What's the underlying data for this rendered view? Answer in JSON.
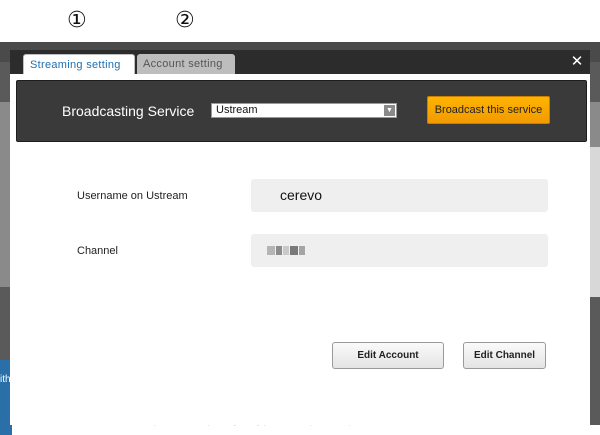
{
  "annotations": [
    "①",
    "②"
  ],
  "background": {
    "left_text": "ith",
    "footer_text": "Online Manual | Terms of Use | Privacy Policy | Contact Us | About Us | 日本語"
  },
  "dialog": {
    "tabs": [
      {
        "label": "Streaming setting",
        "active": true
      },
      {
        "label": "Account setting",
        "active": false
      }
    ],
    "close_label": "✕",
    "service": {
      "label": "Broadcasting Service",
      "selected": "Ustream",
      "broadcast_button": "Broadcast this service"
    },
    "username": {
      "label": "Username on Ustream",
      "value": "cerevo"
    },
    "channel": {
      "label": "Channel"
    },
    "buttons": {
      "edit_account": "Edit Account",
      "edit_channel": "Edit Channel"
    }
  }
}
